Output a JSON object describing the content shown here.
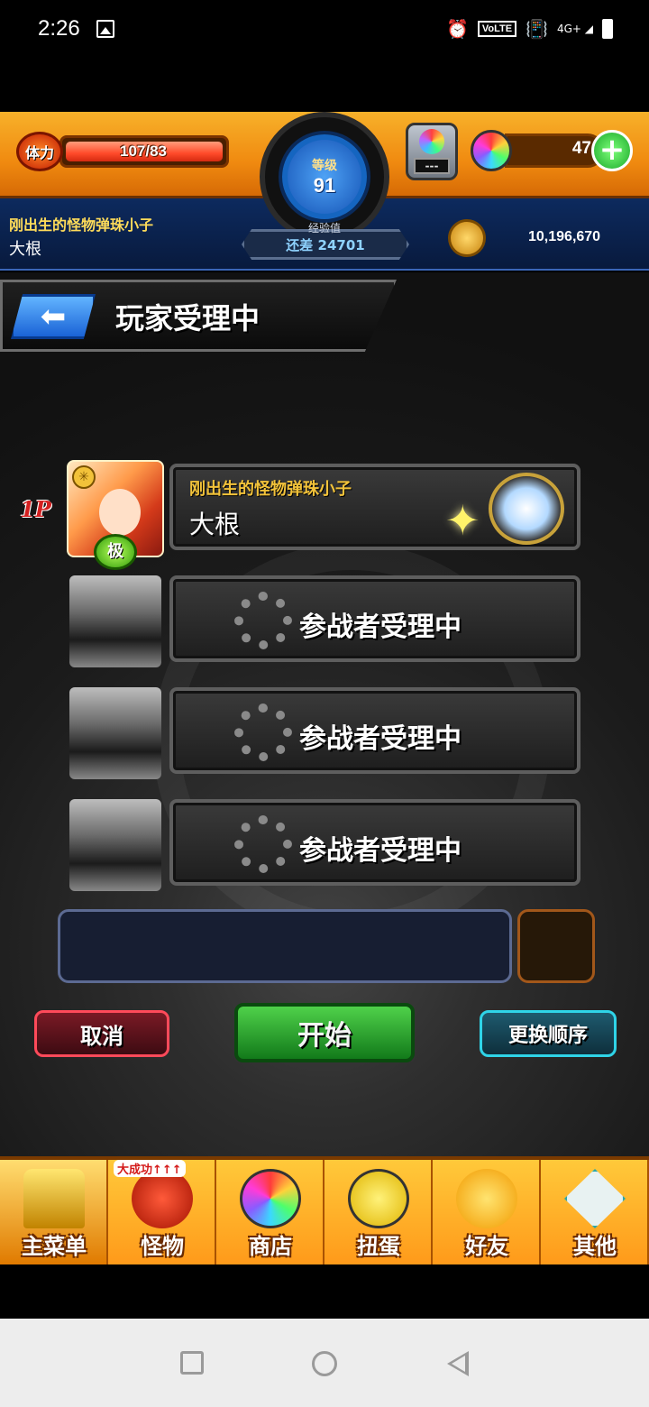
{
  "status_bar": {
    "time": "2:26",
    "volte": "VoLTE",
    "network": "4G+",
    "icons": [
      "image-icon",
      "alarm-icon",
      "vibrate-icon",
      "signal-icon",
      "battery-icon"
    ]
  },
  "hud": {
    "stamina_label": "体力",
    "stamina_value": "107/83",
    "stamina_fill_fraction": 1.0,
    "level_label": "等级",
    "level_value": "91",
    "exp_label": "经验值",
    "exp_remaining": "还差 24701",
    "gem_machine_display": "---",
    "orb_count": "47",
    "coins": "10,196,670",
    "player_title": "刚出生的怪物弹珠小子",
    "player_name": "大根"
  },
  "page": {
    "title": "玩家受理中",
    "back_icon": "back-arrow-icon"
  },
  "slots": [
    {
      "tag": "1P",
      "title": "刚出生的怪物弹珠小子",
      "name": "大根",
      "avatar_badge": "极",
      "avatar_star": "✳"
    },
    {
      "status": "参战者受理中"
    },
    {
      "status": "参战者受理中"
    },
    {
      "status": "参战者受理中"
    }
  ],
  "buttons": {
    "cancel": "取消",
    "start": "开始",
    "change_order": "更换顺序"
  },
  "bottom_nav": [
    {
      "label": "主菜单",
      "icon": "home-gate-icon",
      "active": true
    },
    {
      "label": "怪物",
      "icon": "monster-icon",
      "tag": "大成功↑↑↑"
    },
    {
      "label": "商店",
      "icon": "rainbow-orb-icon"
    },
    {
      "label": "扭蛋",
      "icon": "egg-icon"
    },
    {
      "label": "好友",
      "icon": "friends-icon"
    },
    {
      "label": "其他",
      "icon": "other-icon"
    }
  ],
  "colors": {
    "hud_orange": "#f08a10",
    "hud_blue": "#081a3d",
    "start_green": "#127a1a",
    "cancel_red": "#ff4a5a",
    "order_cyan": "#2fd4e8"
  }
}
